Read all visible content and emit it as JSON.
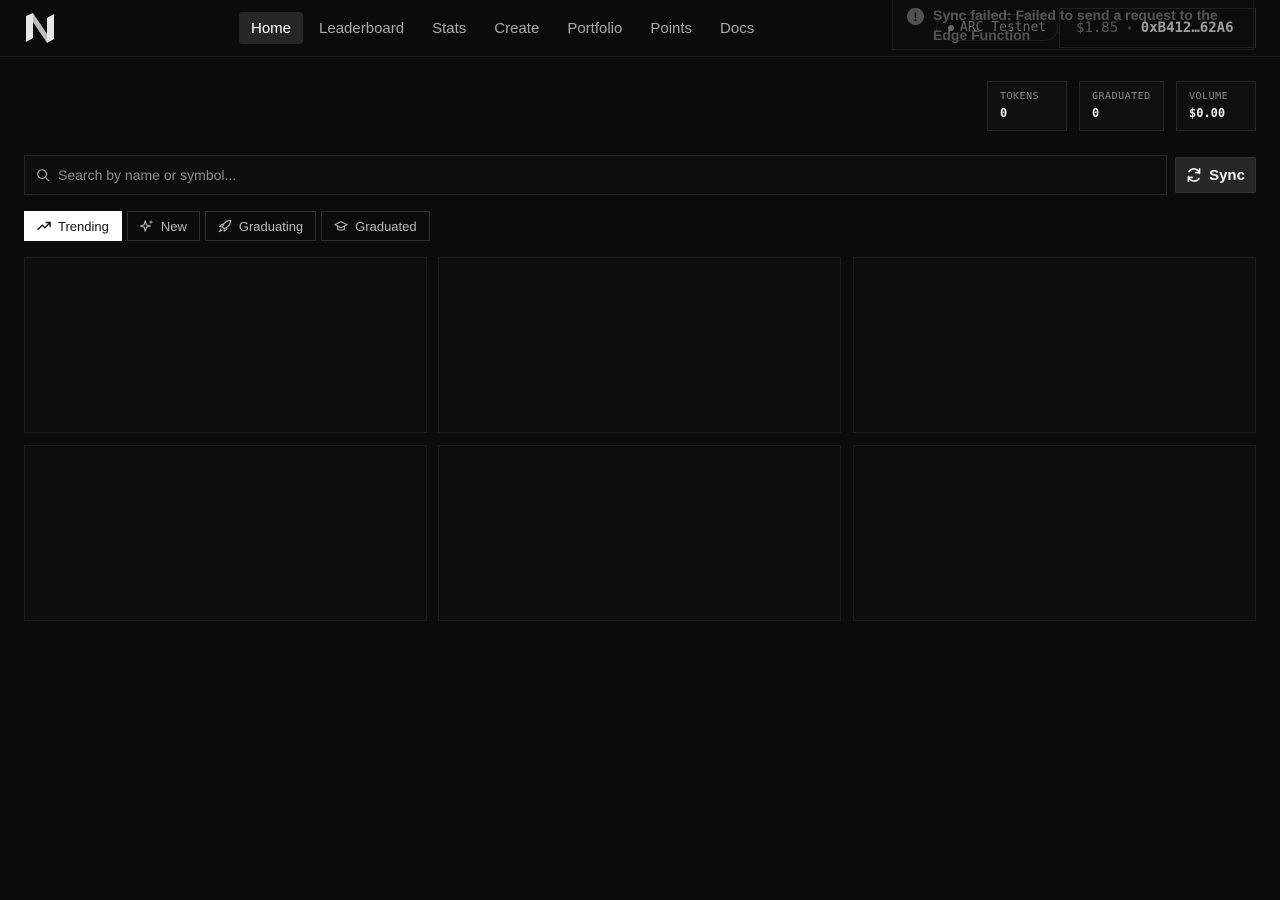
{
  "header": {
    "nav": [
      {
        "label": "Home",
        "active": true
      },
      {
        "label": "Leaderboard"
      },
      {
        "label": "Stats"
      },
      {
        "label": "Create"
      },
      {
        "label": "Portfolio"
      },
      {
        "label": "Points"
      },
      {
        "label": "Docs"
      }
    ],
    "network": "ARC Testnet",
    "price": "$1.85",
    "separator": "•",
    "address": "0xB412…62A6"
  },
  "toast": {
    "icon": "alert-circle-icon",
    "message": "Sync failed: Failed to send a request to the Edge Function"
  },
  "stats": [
    {
      "label": "TOKENS",
      "value": "0"
    },
    {
      "label": "GRADUATED",
      "value": "0"
    },
    {
      "label": "VOLUME",
      "value": "$0.00"
    }
  ],
  "search": {
    "placeholder": "Search by name or symbol...",
    "value": ""
  },
  "sync_button": {
    "label": "Sync",
    "icon": "refresh-icon"
  },
  "filters": [
    {
      "label": "Trending",
      "icon": "trending-up-icon",
      "active": true
    },
    {
      "label": "New",
      "icon": "sparkles-icon"
    },
    {
      "label": "Graduating",
      "icon": "rocket-icon"
    },
    {
      "label": "Graduated",
      "icon": "graduation-cap-icon"
    }
  ],
  "colors": {
    "background": "#0b0b0b",
    "active_tab": "#ffffff",
    "nav_active": "#262626"
  }
}
